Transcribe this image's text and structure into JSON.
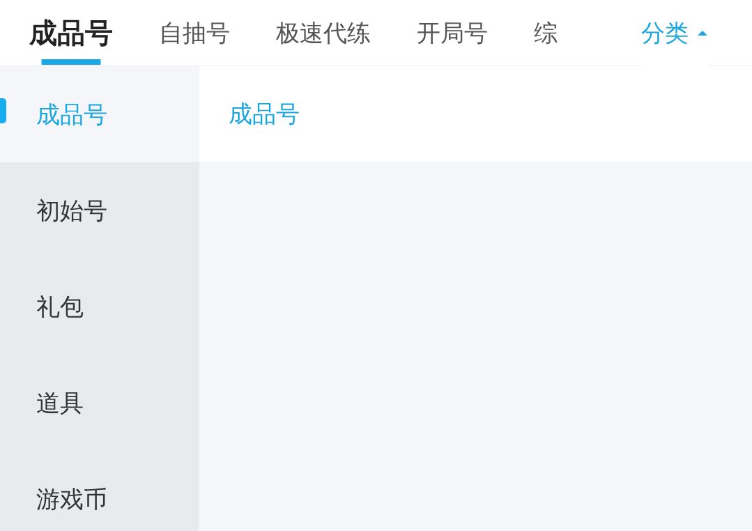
{
  "tabs": [
    {
      "label": "成品号",
      "selected": true
    },
    {
      "label": "自抽号",
      "selected": false
    },
    {
      "label": "极速代练",
      "selected": false
    },
    {
      "label": "开局号",
      "selected": false
    },
    {
      "label": "综",
      "selected": false
    }
  ],
  "category_toggle": {
    "label": "分类",
    "expanded": true
  },
  "sidebar": {
    "items": [
      {
        "label": "成品号",
        "selected": true
      },
      {
        "label": "初始号",
        "selected": false
      },
      {
        "label": "礼包",
        "selected": false
      },
      {
        "label": "道具",
        "selected": false
      },
      {
        "label": "游戏币",
        "selected": false
      }
    ]
  },
  "content": {
    "heading": "成品号"
  }
}
